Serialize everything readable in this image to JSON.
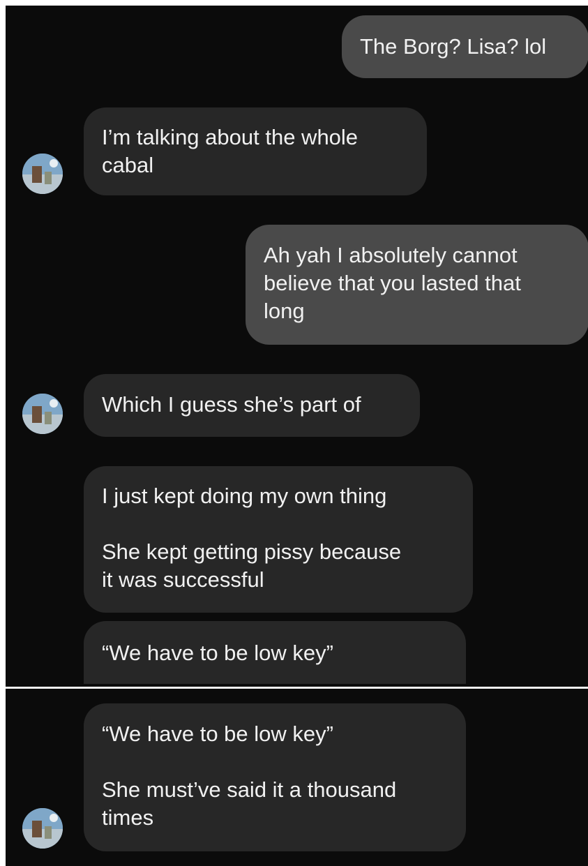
{
  "conversation": {
    "messages": [
      {
        "direction": "sent",
        "text": "The Borg? Lisa? lol"
      },
      {
        "direction": "received",
        "text": "I’m talking about the whole\ncabal"
      },
      {
        "direction": "sent",
        "text": "Ah yah I absolutely cannot\nbelieve that you lasted that\nlong"
      },
      {
        "direction": "received",
        "text": "Which I guess she’s part of"
      },
      {
        "direction": "received",
        "text": "I just kept doing my own thing\n\nShe kept getting pissy because\nit was successful"
      },
      {
        "direction": "received",
        "text": "“We have to be low key”"
      }
    ],
    "continued_messages": [
      {
        "direction": "received",
        "text": "“We have to be low key”\n\nShe must’ve said it a thousand\ntimes"
      }
    ]
  },
  "avatar": {
    "icon": "contact-avatar-photo"
  },
  "colors": {
    "background": "#0b0b0b",
    "sent_bubble": "#4a4a4a",
    "received_bubble": "#272727",
    "text": "#f1f1f1"
  }
}
